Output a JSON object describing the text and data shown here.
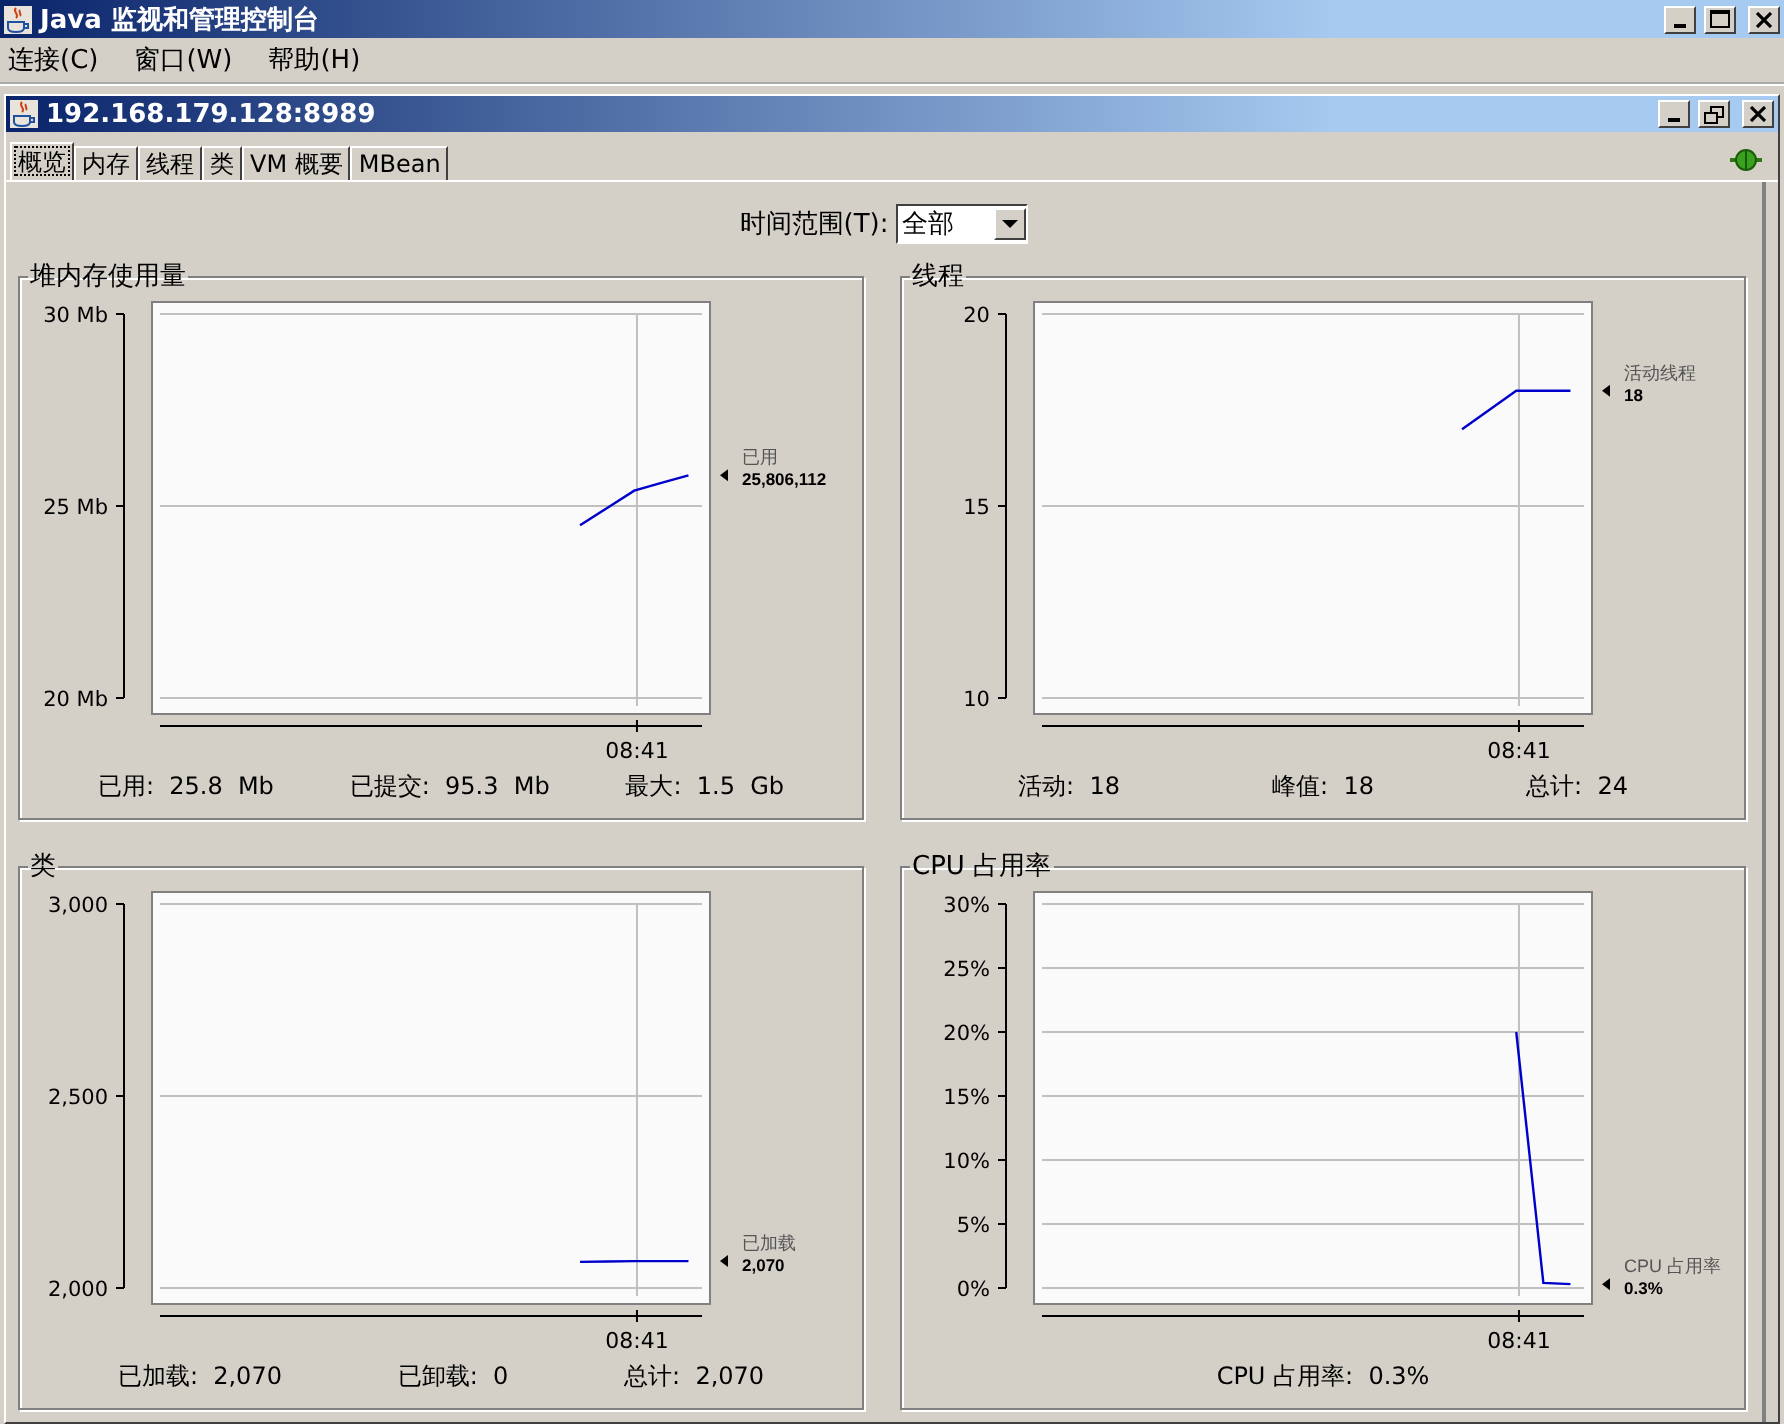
{
  "window": {
    "title": "Java 监视和管理控制台"
  },
  "menu": [
    {
      "label": "连接(C)"
    },
    {
      "label": "窗口(W)"
    },
    {
      "label": "帮助(H)"
    }
  ],
  "connection": {
    "title": "192.168.179.128:8989",
    "tabs": [
      {
        "label": "概览",
        "selected": true
      },
      {
        "label": "内存",
        "selected": false
      },
      {
        "label": "线程",
        "selected": false
      },
      {
        "label": "类",
        "selected": false
      },
      {
        "label": "VM 概要",
        "selected": false
      },
      {
        "label": "MBean",
        "selected": false
      }
    ],
    "time_range": {
      "label": "时间范围(T):",
      "value": "全部"
    },
    "panels": [
      {
        "title": "堆内存使用量",
        "legend_value": "25,806,112",
        "stats": [
          {
            "label": "已用:",
            "value": "25.8  Mb"
          },
          {
            "label": "已提交:",
            "value": "95.3  Mb"
          },
          {
            "label": "最大:",
            "value": "1.5  Gb"
          }
        ],
        "chart_data": {
          "type": "line",
          "grid": true,
          "annotations": [
            "08:41"
          ],
          "ylim": [
            20,
            30
          ],
          "yticks": [
            {
              "value": 20,
              "label": "20 Mb"
            },
            {
              "value": 25,
              "label": "25 Mb"
            },
            {
              "value": 30,
              "label": "30 Mb"
            }
          ],
          "series": [
            {
              "name": "已用",
              "color": "#0000cc",
              "values": [
                null,
                null,
                null,
                null,
                null,
                null,
                null,
                null,
                null,
                null,
                null,
                null,
                null,
                null,
                null,
                24.5,
                24.95,
                25.4,
                25.6,
                25.8
              ]
            }
          ]
        }
      },
      {
        "title": "线程",
        "legend_value": "18",
        "stats": [
          {
            "label": "活动:",
            "value": "18"
          },
          {
            "label": "峰值:",
            "value": "18"
          },
          {
            "label": "总计:",
            "value": "24"
          }
        ],
        "chart_data": {
          "type": "line",
          "grid": true,
          "annotations": [
            "08:41"
          ],
          "ylim": [
            10,
            20
          ],
          "yticks": [
            {
              "value": 10,
              "label": "10"
            },
            {
              "value": 15,
              "label": "15"
            },
            {
              "value": 20,
              "label": "20"
            }
          ],
          "series": [
            {
              "name": "活动线程",
              "color": "#0000cc",
              "values": [
                null,
                null,
                null,
                null,
                null,
                null,
                null,
                null,
                null,
                null,
                null,
                null,
                null,
                null,
                null,
                17,
                17.5,
                18,
                18,
                18
              ]
            }
          ]
        }
      },
      {
        "title": "类",
        "legend_value": "2,070",
        "stats": [
          {
            "label": "已加载:",
            "value": "2,070"
          },
          {
            "label": "已卸载:",
            "value": "0"
          },
          {
            "label": "总计:",
            "value": "2,070"
          }
        ],
        "chart_data": {
          "type": "line",
          "grid": true,
          "annotations": [
            "08:41"
          ],
          "ylim": [
            2000,
            3000
          ],
          "yticks": [
            {
              "value": 2000,
              "label": "2,000"
            },
            {
              "value": 2500,
              "label": "2,500"
            },
            {
              "value": 3000,
              "label": "3,000"
            }
          ],
          "series": [
            {
              "name": "已加载",
              "color": "#0000cc",
              "values": [
                null,
                null,
                null,
                null,
                null,
                null,
                null,
                null,
                null,
                null,
                null,
                null,
                null,
                null,
                null,
                2068,
                2069,
                2070,
                2070,
                2070
              ]
            }
          ]
        }
      },
      {
        "title": "CPU 占用率",
        "legend_value": "0.3%",
        "stats": [
          {
            "label": "CPU 占用率:",
            "value": "0.3%"
          }
        ],
        "chart_data": {
          "type": "line",
          "grid": true,
          "annotations": [
            "08:41"
          ],
          "ylim": [
            0,
            30
          ],
          "yticks": [
            {
              "value": 0,
              "label": "0%"
            },
            {
              "value": 5,
              "label": "5%"
            },
            {
              "value": 10,
              "label": "10%"
            },
            {
              "value": 15,
              "label": "15%"
            },
            {
              "value": 20,
              "label": "20%"
            },
            {
              "value": 25,
              "label": "25%"
            },
            {
              "value": 30,
              "label": "30%"
            }
          ],
          "series": [
            {
              "name": "CPU 占用率",
              "color": "#0000cc",
              "values": [
                null,
                null,
                null,
                null,
                null,
                null,
                null,
                null,
                null,
                null,
                null,
                null,
                null,
                null,
                null,
                null,
                null,
                20,
                0.4,
                0.3
              ]
            }
          ]
        }
      }
    ]
  }
}
